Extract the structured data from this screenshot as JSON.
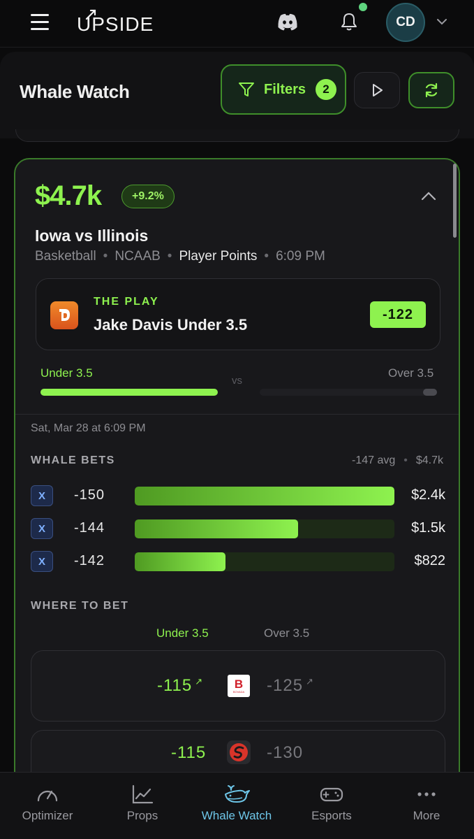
{
  "app": {
    "logo_text": "UPSIDE",
    "avatar_initials": "CD",
    "notification_dot": true
  },
  "header": {
    "title": "Whale Watch",
    "filters_label": "Filters",
    "filters_count": "2"
  },
  "card": {
    "amount": "$4.7k",
    "change_pct": "+9.2%",
    "matchup": "Iowa vs Illinois",
    "meta": {
      "sport": "Basketball",
      "league": "NCAAB",
      "market": "Player Points",
      "time": "6:09 PM"
    },
    "play": {
      "kicker": "THE PLAY",
      "selection": "Jake Davis Under 3.5",
      "odds": "-122",
      "book_icon": "draftkings-pick6-logo"
    },
    "split": {
      "left_label": "Under 3.5",
      "vs": "vs",
      "right_label": "Over 3.5",
      "left_share": 0.98,
      "right_share": 0.08
    },
    "date": "Sat, Mar 28 at 6:09 PM",
    "whale_bets": {
      "label": "WHALE BETS",
      "avg": "-147 avg",
      "total": "$4.7k",
      "rows": [
        {
          "book": "X",
          "odds": "-150",
          "amount": "$2.4k",
          "fill": 1.0
        },
        {
          "book": "X",
          "odds": "-144",
          "amount": "$1.5k",
          "fill": 0.63
        },
        {
          "book": "X",
          "odds": "-142",
          "amount": "$822",
          "fill": 0.35
        }
      ]
    },
    "where_to_bet": {
      "label": "WHERE TO BET",
      "under_header": "Under 3.5",
      "over_header": "Over 3.5",
      "rows": [
        {
          "under": "-115",
          "over": "-125",
          "book_letter": "B",
          "book_tag": "BOVADA",
          "book_icon": "bovada-logo"
        },
        {
          "under": "-115",
          "over": "-130",
          "book_icon": "swirl-book-logo"
        }
      ]
    }
  },
  "colors": {
    "accent": "#8ef24f",
    "active_nav": "#6ec6e8",
    "card_border": "#3a7a2a"
  },
  "nav": [
    {
      "label": "Optimizer",
      "icon": "gauge-icon"
    },
    {
      "label": "Props",
      "icon": "chart-line-icon"
    },
    {
      "label": "Whale Watch",
      "icon": "whale-icon",
      "active": true
    },
    {
      "label": "Esports",
      "icon": "gamepad-icon"
    },
    {
      "label": "More",
      "icon": "more-dots-icon"
    }
  ]
}
